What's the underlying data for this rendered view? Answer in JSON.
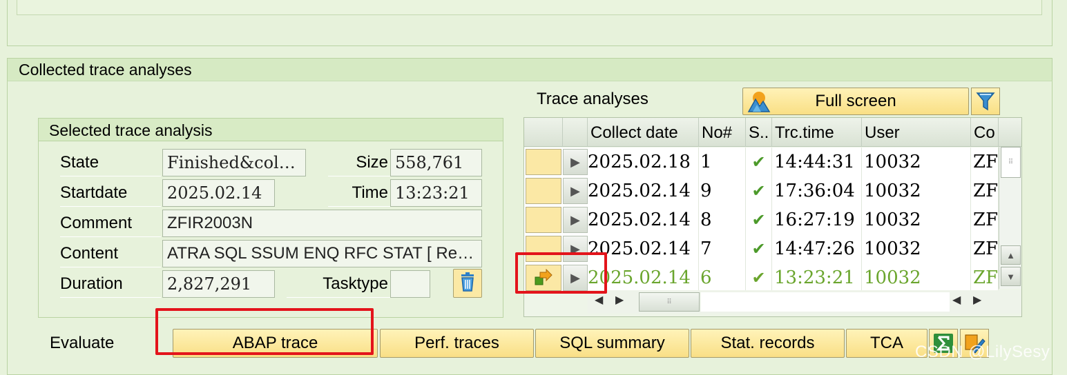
{
  "group_title": "Collected trace analyses",
  "selected_panel": {
    "title": "Selected trace analysis",
    "state_label": "State",
    "state_value": "Finished&col…",
    "size_label": "Size",
    "size_value": "558,761",
    "startdate_label": "Startdate",
    "startdate_value": "2025.02.14",
    "time_label": "Time",
    "time_value": "13:23:21",
    "comment_label": "Comment",
    "comment_value": "ZFIR2003N",
    "content_label": "Content",
    "content_value": "ATRA SQL SSUM ENQ RFC STAT [ Re…",
    "duration_label": "Duration",
    "duration_value": "2,827,291",
    "tasktype_label": "Tasktype",
    "tasktype_value": "",
    "delete_icon": "trash-icon"
  },
  "trace_analyses": {
    "label": "Trace analyses",
    "fullscreen_label": "Full screen",
    "columns": [
      "Collect date",
      "No#",
      "S..",
      "Trc.time",
      "User",
      "Co"
    ],
    "rows": [
      {
        "date": "2025.02.18",
        "no": "1",
        "status": "✔",
        "time": "14:44:31",
        "user": "10032",
        "co": "ZFI"
      },
      {
        "date": "2025.02.14",
        "no": "9",
        "status": "✔",
        "time": "17:36:04",
        "user": "10032",
        "co": "ZFI"
      },
      {
        "date": "2025.02.14",
        "no": "8",
        "status": "✔",
        "time": "16:27:19",
        "user": "10032",
        "co": "ZFI"
      },
      {
        "date": "2025.02.14",
        "no": "7",
        "status": "✔",
        "time": "14:47:26",
        "user": "10032",
        "co": "ZFI"
      },
      {
        "date": "2025.02.14",
        "no": "6",
        "status": "✔",
        "time": "13:23:21",
        "user": "10032",
        "co": "ZFI"
      }
    ]
  },
  "evaluate": {
    "label": "Evaluate",
    "abap_trace": "ABAP trace",
    "perf_traces": "Perf. traces",
    "sql_summary": "SQL summary",
    "stat_records": "Stat. records",
    "tca": "TCA"
  },
  "watermark": "CSDN @LilySesy",
  "colors": {
    "background": "#e7f2db",
    "button_yellow": "#f9df86",
    "highlight_red": "#e3141b",
    "active_row_green": "#6aa52d"
  }
}
